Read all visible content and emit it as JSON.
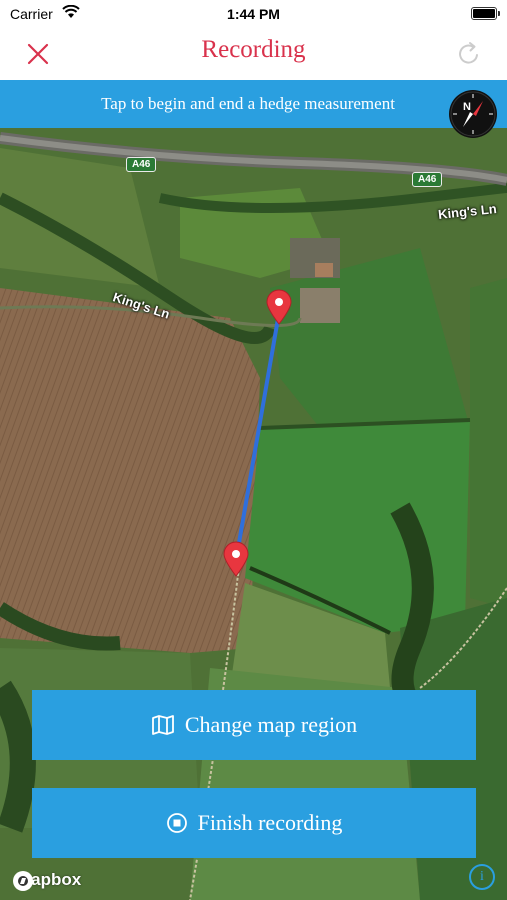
{
  "status": {
    "carrier": "Carrier",
    "time": "1:44 PM"
  },
  "nav": {
    "title": "Recording"
  },
  "banner": {
    "text": "Tap to begin and end a hedge measurement"
  },
  "compass": {
    "letter": "N"
  },
  "map": {
    "road_badges": [
      "A46",
      "A46"
    ],
    "road_labels": [
      "King's Ln",
      "King's Ln"
    ]
  },
  "buttons": {
    "change_region": "Change map region",
    "finish_recording": "Finish recording"
  },
  "attribution": {
    "logo_text": "mapbox",
    "info_symbol": "i"
  },
  "colors": {
    "accent": "#2a9fe0",
    "title": "#d9324c",
    "pin": "#e8363f",
    "measure_line": "#2f6fdc"
  }
}
